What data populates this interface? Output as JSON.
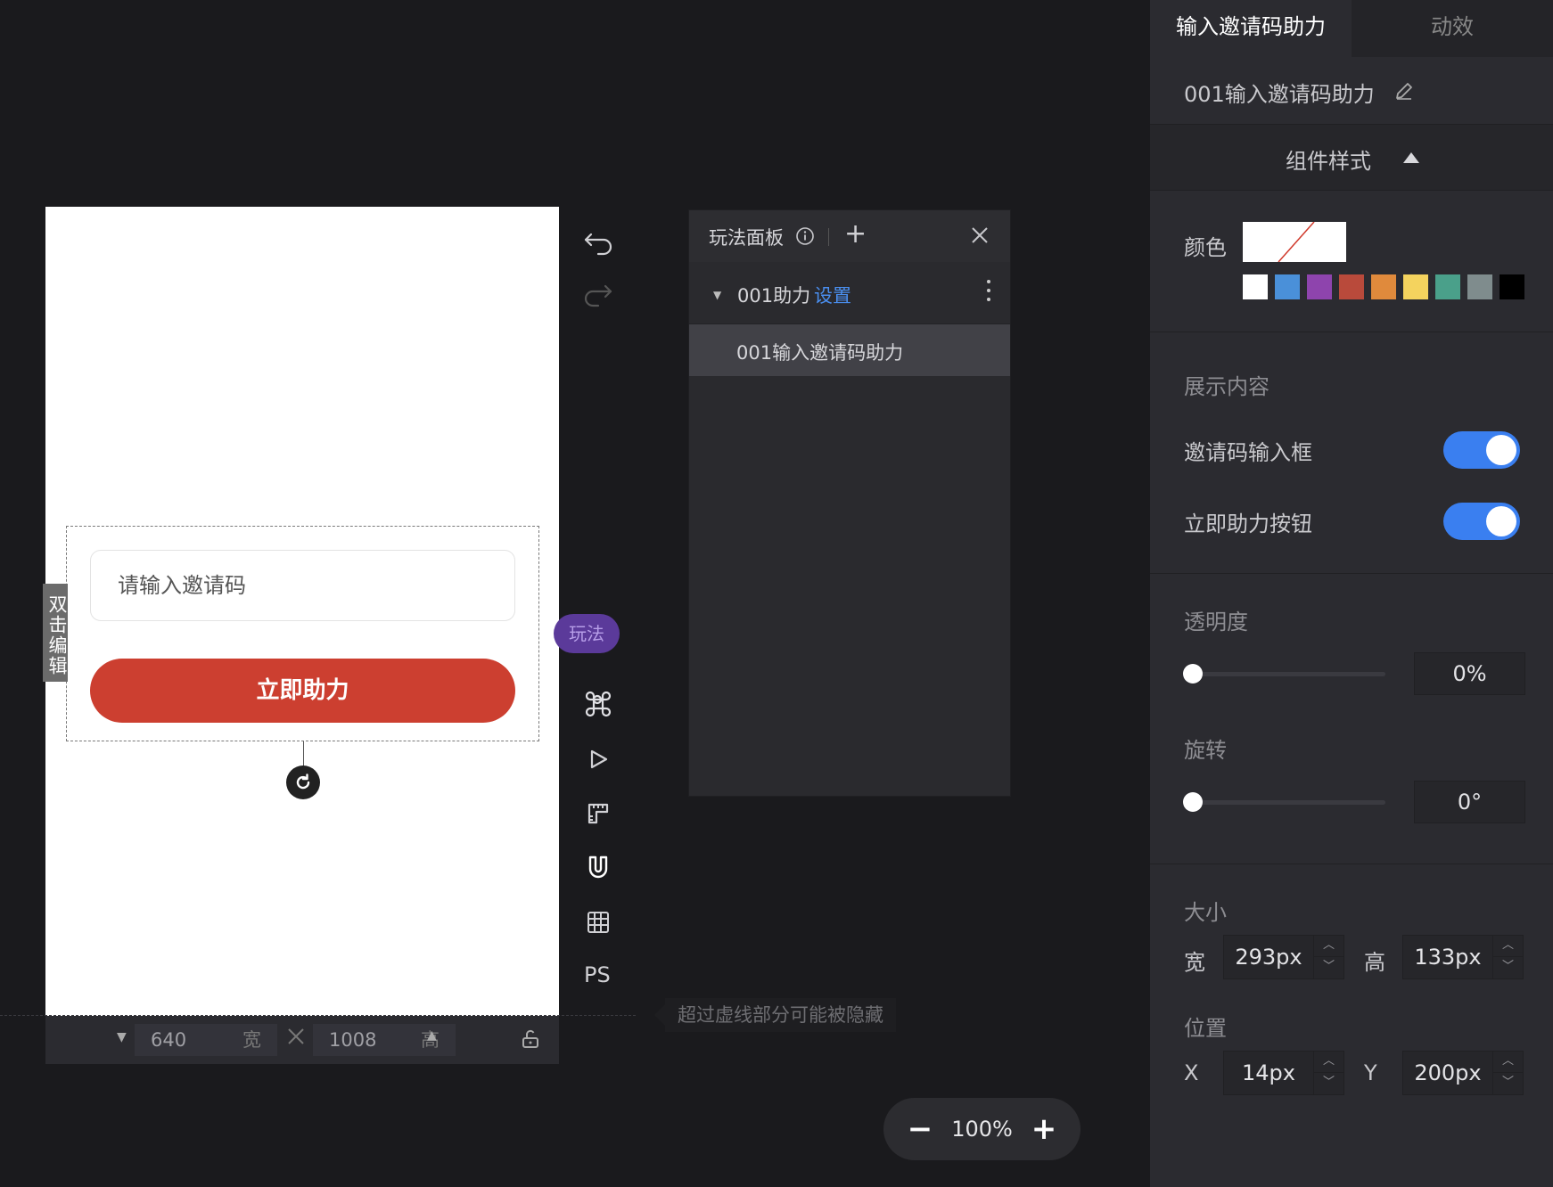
{
  "canvas": {
    "double_click_edit": "双击编辑",
    "input_placeholder": "请输入邀请码",
    "help_button": "立即助力",
    "width_value": "640",
    "width_unit": "宽",
    "height_value": "1008",
    "height_unit": "高",
    "hint": "超过虚线部分可能被隐藏"
  },
  "toolbar": {
    "play_badge": "玩法",
    "ps_label": "PS"
  },
  "zoom": {
    "minus": "−",
    "value": "100%",
    "plus": "+"
  },
  "play_panel": {
    "title": "玩法面板",
    "add": "+",
    "group_name": "001助力",
    "group_settings": "设置",
    "item": "001输入邀请码助力"
  },
  "inspector": {
    "tab_active": "输入邀请码助力",
    "tab_animation": "动效",
    "component_name": "001输入邀请码助力",
    "section_title": "组件样式",
    "color_label": "颜色",
    "palette": [
      "#ffffff",
      "#4a90d9",
      "#8e44ad",
      "#b94a3b",
      "#e08a3c",
      "#f4d35e",
      "#4aa08a",
      "#7f8c8d",
      "#000000"
    ],
    "display_content_label": "展示内容",
    "toggle_input_label": "邀请码输入框",
    "toggle_input_on": true,
    "toggle_button_label": "立即助力按钮",
    "toggle_button_on": true,
    "opacity_label": "透明度",
    "opacity_value": "0%",
    "rotation_label": "旋转",
    "rotation_value": "0°",
    "size_label": "大小",
    "width_label": "宽",
    "width_value": "293px",
    "height_label": "高",
    "height_value": "133px",
    "position_label": "位置",
    "x_label": "X",
    "x_value": "14px",
    "y_label": "Y",
    "y_value": "200px",
    "accent_color": "#3a7ff0",
    "button_color": "#cc3f30"
  }
}
